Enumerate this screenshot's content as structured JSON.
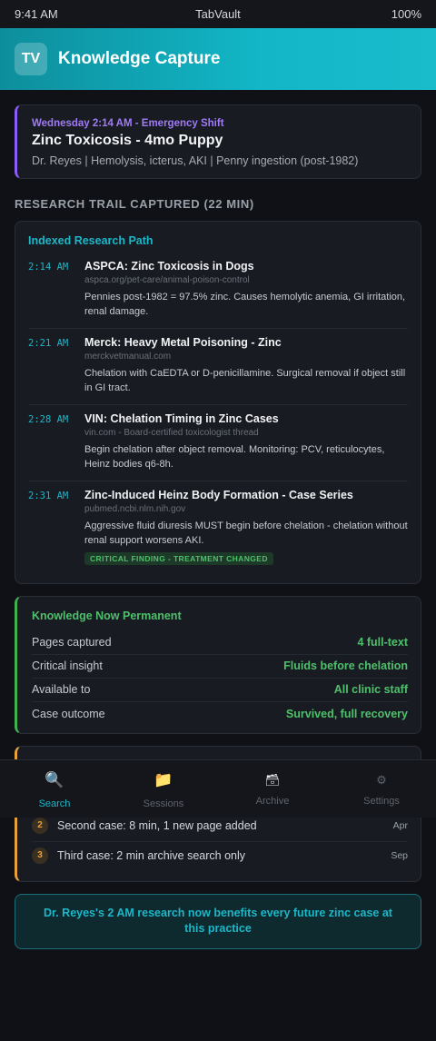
{
  "status_bar": {
    "time": "9:41 AM",
    "app": "TabVault",
    "battery": "100%"
  },
  "header": {
    "logo": "TV",
    "title": "Knowledge Capture"
  },
  "case": {
    "shift": "Wednesday 2:14 AM - Emergency Shift",
    "title": "Zinc Toxicosis - 4mo Puppy",
    "details": "Dr. Reyes | Hemolysis, icterus, AKI | Penny ingestion (post-1982)"
  },
  "research_section_title": "RESEARCH TRAIL CAPTURED (22 MIN)",
  "trail": {
    "heading": "Indexed Research Path",
    "items": [
      {
        "time": "2:14 AM",
        "title": "ASPCA: Zinc Toxicosis in Dogs",
        "url": "aspca.org/pet-care/animal-poison-control",
        "note": "Pennies post-1982 = 97.5% zinc. Causes hemolytic anemia, GI irritation, renal damage."
      },
      {
        "time": "2:21 AM",
        "title": "Merck: Heavy Metal Poisoning - Zinc",
        "url": "merckvetmanual.com",
        "note": "Chelation with CaEDTA or D-penicillamine. Surgical removal if object still in GI tract."
      },
      {
        "time": "2:28 AM",
        "title": "VIN: Chelation Timing in Zinc Cases",
        "url": "vin.com - Board-certified toxicologist thread",
        "note": "Begin chelation after object removal. Monitoring: PCV, reticulocytes, Heinz bodies q6-8h."
      },
      {
        "time": "2:31 AM",
        "title": "Zinc-Induced Heinz Body Formation - Case Series",
        "url": "pubmed.ncbi.nlm.nih.gov",
        "note": "Aggressive fluid diuresis MUST begin before chelation - chelation without renal support worsens AKI.",
        "badge": "CRITICAL FINDING - TREATMENT CHANGED"
      }
    ]
  },
  "permanent": {
    "heading": "Knowledge Now Permanent",
    "rows": [
      {
        "label": "Pages captured",
        "value": "4 full-text"
      },
      {
        "label": "Critical insight",
        "value": "Fluids before chelation"
      },
      {
        "label": "Available to",
        "value": "All clinic staff"
      },
      {
        "label": "Case outcome",
        "value": "Survived, full recovery"
      }
    ]
  },
  "timeline": {
    "rows": [
      {
        "num": "2",
        "text": "Second case: 8 min, 1 new page added",
        "date": "Apr"
      },
      {
        "num": "3",
        "text": "Third case: 2 min archive search only",
        "date": "Sep"
      }
    ]
  },
  "footer_banner": "Dr. Reyes's 2 AM research now benefits every future zinc case at this practice",
  "tabs": [
    {
      "label": "Search",
      "icon": "magnifier-icon",
      "glyph": "🔍",
      "active": true
    },
    {
      "label": "Sessions",
      "icon": "folder-icon",
      "glyph": "📁"
    },
    {
      "label": "Archive",
      "icon": "card-box-icon",
      "glyph": "🗃"
    },
    {
      "label": "Settings",
      "icon": "gear-icon",
      "glyph": "⚙"
    }
  ],
  "colors": {
    "accent": "#1cb7c8",
    "purple": "#8b5cf6",
    "green": "#4ec06b",
    "amber": "#e5a13a",
    "background": "#0f1117"
  }
}
